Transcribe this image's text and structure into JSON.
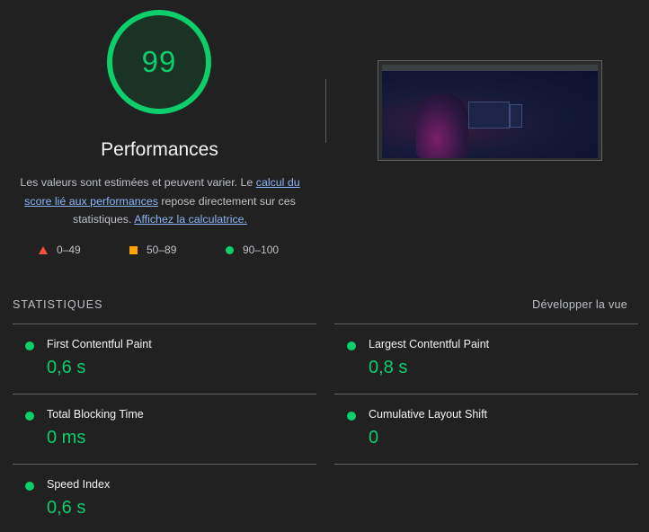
{
  "gauge": {
    "score": "99",
    "title": "Performances",
    "color": "#0cce6b"
  },
  "description": {
    "text_1": "Les valeurs sont estimées et peuvent varier. Le ",
    "link_1": "calcul du score lié aux performances",
    "text_2": " repose directement sur ces statistiques. ",
    "link_2": "Affichez la calculatrice."
  },
  "legend": [
    {
      "icon": "red-triangle-icon",
      "label": "0–49",
      "color": "#ff4e42"
    },
    {
      "icon": "orange-square-icon",
      "label": "50–89",
      "color": "#ffa400"
    },
    {
      "icon": "green-circle-icon",
      "label": "90–100",
      "color": "#0cce6b"
    }
  ],
  "screenshot": {
    "icon": "page-screenshot-thumbnail"
  },
  "metrics_section": {
    "title": "STATISTIQUES",
    "toggle_label": "Développer la vue"
  },
  "metrics": [
    {
      "name": "First Contentful Paint",
      "value": "0,6 s",
      "status_color": "#0cce6b"
    },
    {
      "name": "Largest Contentful Paint",
      "value": "0,8 s",
      "status_color": "#0cce6b"
    },
    {
      "name": "Total Blocking Time",
      "value": "0 ms",
      "status_color": "#0cce6b"
    },
    {
      "name": "Cumulative Layout Shift",
      "value": "0",
      "status_color": "#0cce6b"
    },
    {
      "name": "Speed Index",
      "value": "0,6 s",
      "status_color": "#0cce6b"
    }
  ]
}
